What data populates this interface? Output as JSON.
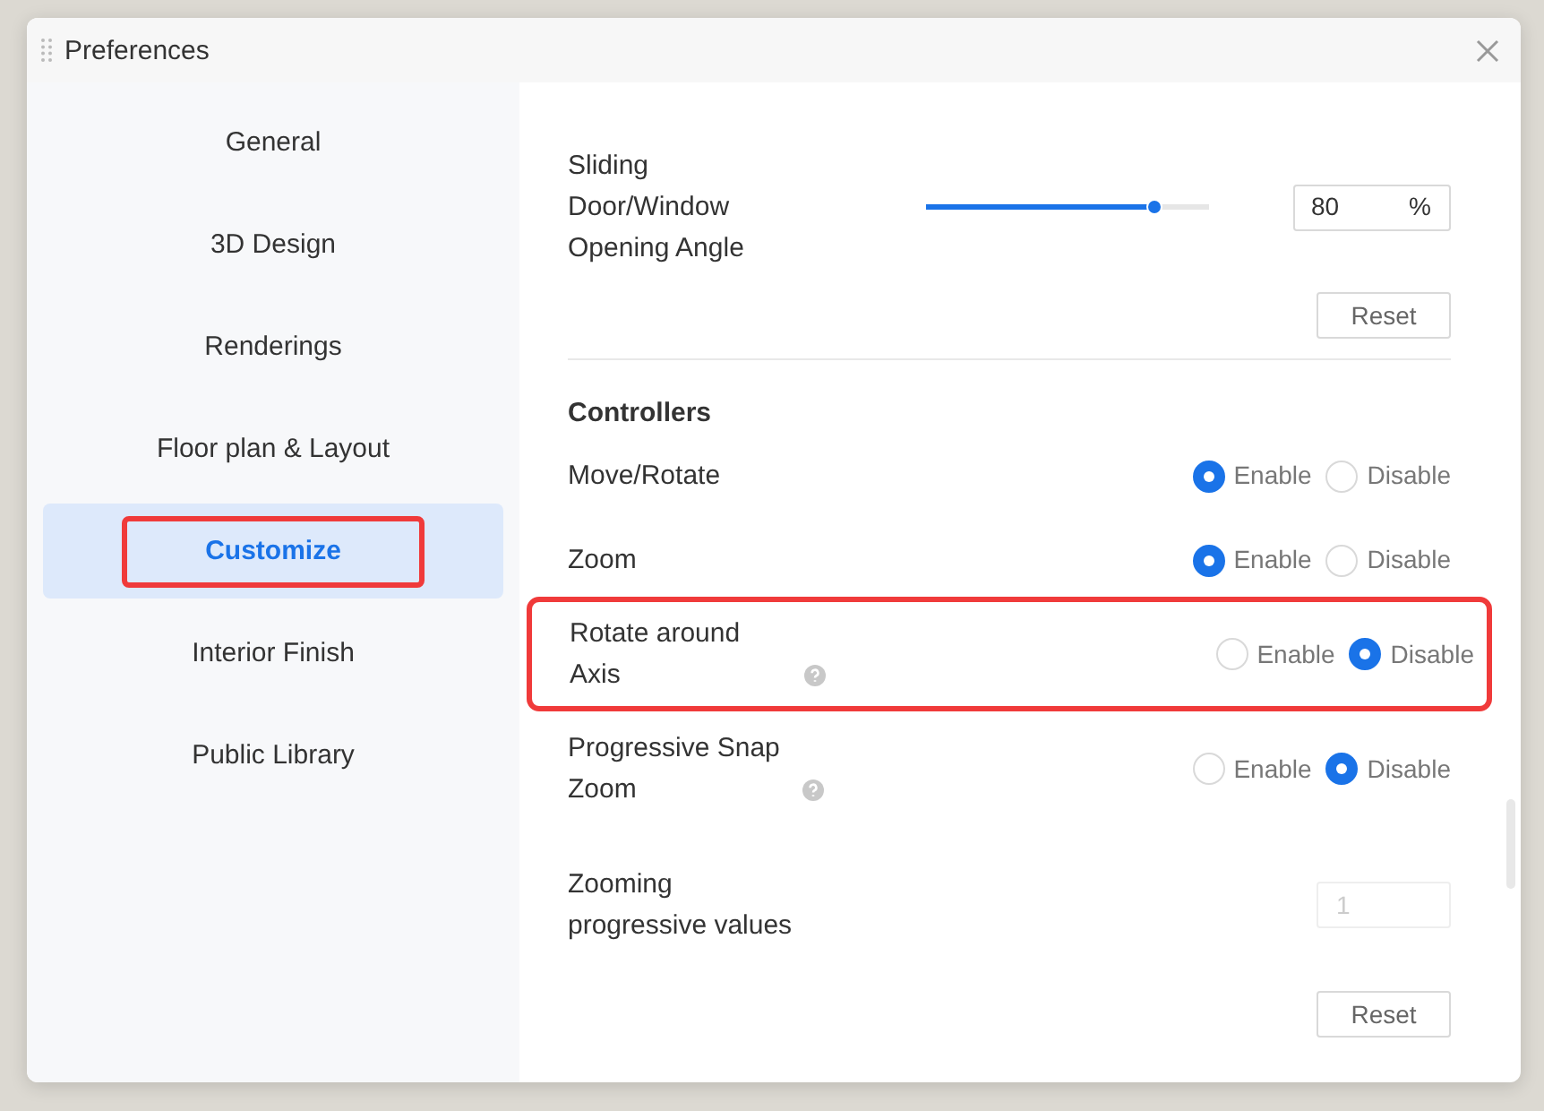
{
  "window": {
    "title": "Preferences"
  },
  "sidebar": {
    "items": [
      {
        "label": "General",
        "selected": false,
        "highlighted": false
      },
      {
        "label": "3D Design",
        "selected": false,
        "highlighted": false
      },
      {
        "label": "Renderings",
        "selected": false,
        "highlighted": false
      },
      {
        "label": "Floor plan & Layout",
        "selected": false,
        "highlighted": false
      },
      {
        "label": "Customize",
        "selected": true,
        "highlighted": true
      },
      {
        "label": "Interior Finish",
        "selected": false,
        "highlighted": false
      },
      {
        "label": "Public Library",
        "selected": false,
        "highlighted": false
      }
    ]
  },
  "content": [
    {
      "kind": "slider",
      "label": "Sliding Door/Window Opening Angle",
      "level": 0.81,
      "value": "80",
      "unit": "%"
    },
    {
      "kind": "reset",
      "label": "Reset"
    },
    {
      "kind": "heading",
      "label": "Controllers"
    },
    {
      "kind": "radio",
      "label": "Move/Rotate",
      "help": false,
      "highlighted": false,
      "options": [
        {
          "label": "Enable",
          "selected": true
        },
        {
          "label": "Disable",
          "selected": false
        }
      ]
    },
    {
      "kind": "radio",
      "label": "Zoom",
      "help": false,
      "highlighted": false,
      "options": [
        {
          "label": "Enable",
          "selected": true
        },
        {
          "label": "Disable",
          "selected": false
        }
      ]
    },
    {
      "kind": "radio",
      "label": "Rotate around Axis",
      "help": true,
      "highlighted": true,
      "options": [
        {
          "label": "Enable",
          "selected": false
        },
        {
          "label": "Disable",
          "selected": true
        }
      ]
    },
    {
      "kind": "radio",
      "label": "Progressive Snap Zoom",
      "help": true,
      "highlighted": false,
      "options": [
        {
          "label": "Enable",
          "selected": false
        },
        {
          "label": "Disable",
          "selected": true
        }
      ]
    },
    {
      "kind": "input",
      "label": "Zooming progressive values",
      "value": "1",
      "disabled": true
    },
    {
      "kind": "reset",
      "label": "Reset"
    }
  ]
}
